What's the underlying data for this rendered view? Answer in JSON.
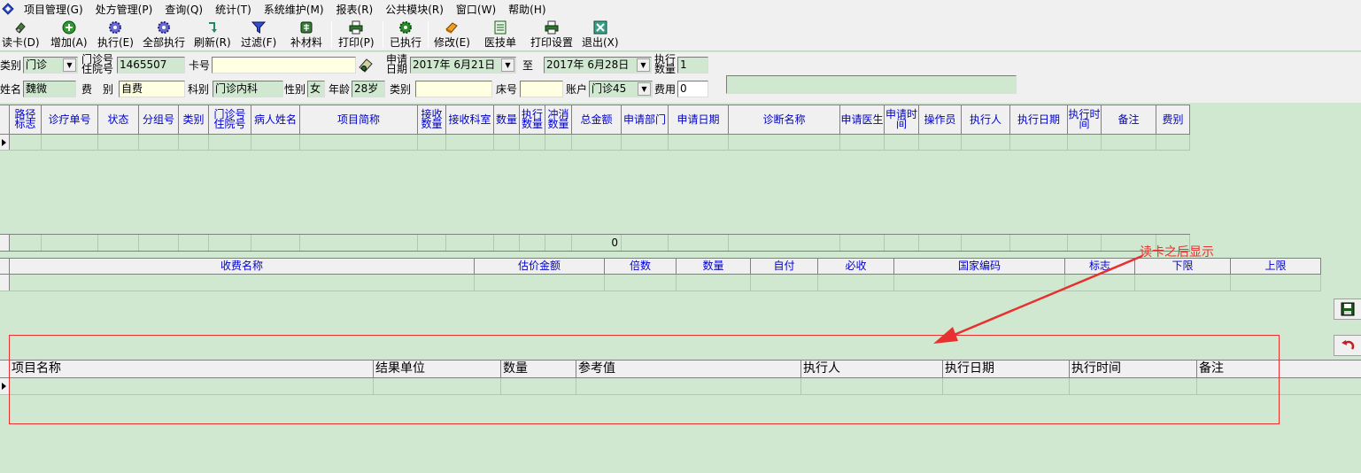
{
  "menubar": {
    "items": [
      "项目管理(G)",
      "处方管理(P)",
      "查询(Q)",
      "统计(T)",
      "系统维护(M)",
      "报表(R)",
      "公共模块(R)",
      "窗口(W)",
      "帮助(H)"
    ]
  },
  "toolbar": {
    "buttons": [
      {
        "label": "读卡(D)",
        "icon": "card-reader-icon"
      },
      {
        "label": "增加(A)",
        "icon": "add-icon"
      },
      {
        "label": "执行(E)",
        "icon": "execute-gear-icon"
      },
      {
        "label": "全部执行",
        "icon": "execute-all-gear-icon"
      },
      {
        "label": "刷新(R)",
        "icon": "refresh-icon"
      },
      {
        "label": "过滤(F)",
        "icon": "filter-icon"
      },
      {
        "label": "补材料",
        "icon": "material-icon"
      },
      {
        "label": "打印(P)",
        "icon": "printer-icon"
      },
      {
        "label": "已执行",
        "icon": "executed-gear-icon"
      },
      {
        "label": "修改(E)",
        "icon": "edit-eraser-icon"
      },
      {
        "label": "医技单",
        "icon": "document-icon"
      },
      {
        "label": "打印设置",
        "icon": "print-settings-icon"
      },
      {
        "label": "退出(X)",
        "icon": "exit-icon"
      }
    ]
  },
  "form": {
    "category_label": "类别",
    "category_value": "门诊",
    "outpatient_no_label_1": "门诊号",
    "outpatient_no_label_2": "住院号",
    "outpatient_no_value": "1465507",
    "card_label": "卡号",
    "card_value": "",
    "apply_date_label_1": "申请",
    "apply_date_label_2": "日期",
    "date_from": "2017年 6月21日",
    "to_label": "至",
    "date_to": "2017年 6月28日",
    "exec_qty_label_1": "执行",
    "exec_qty_label_2": "数量",
    "exec_qty_value": "1",
    "name_label": "姓名",
    "name_value": "魏微",
    "fee_label": "费　别",
    "fee_value": "自费",
    "dept_label": "科别",
    "dept_value": "门诊内科",
    "gender_label": "性别",
    "gender_value": "女",
    "age_label": "年龄",
    "age_value": "28岁",
    "category2_label": "类别",
    "category2_value": "",
    "bed_label": "床号",
    "bed_value": "",
    "account_label": "账户",
    "account_value": "门诊45",
    "charge_label": "费用",
    "charge_value": "0",
    "status_box_value": ""
  },
  "grid1": {
    "columns": [
      "路径标志",
      "诊疗单号",
      "状态",
      "分组号",
      "类别",
      "门诊号住院号",
      "病人姓名",
      "项目简称",
      "接收数量",
      "接收科室",
      "数量",
      "执行数量",
      "冲消数量",
      "总金额",
      "申请部门",
      "申请日期",
      "诊断名称",
      "申请医生",
      "申请时间",
      "操作员",
      "执行人",
      "执行日期",
      "执行时间",
      "备注",
      "费别"
    ],
    "total_value": "0"
  },
  "grid2": {
    "columns": [
      "收费名称",
      "估价金额",
      "倍数",
      "数量",
      "自付",
      "必收",
      "国家编码",
      "标志",
      "下限",
      "上限"
    ]
  },
  "grid3": {
    "columns": [
      "项目名称",
      "结果单位",
      "数量",
      "参考值",
      "执行人",
      "执行日期",
      "执行时间",
      "备注"
    ]
  },
  "annotation": {
    "text": "读卡之后显示",
    "color": "#e83030"
  },
  "colors": {
    "background": "#cfe8cf",
    "header_text": "#0000cc",
    "chrome": "#f0f0f0"
  }
}
